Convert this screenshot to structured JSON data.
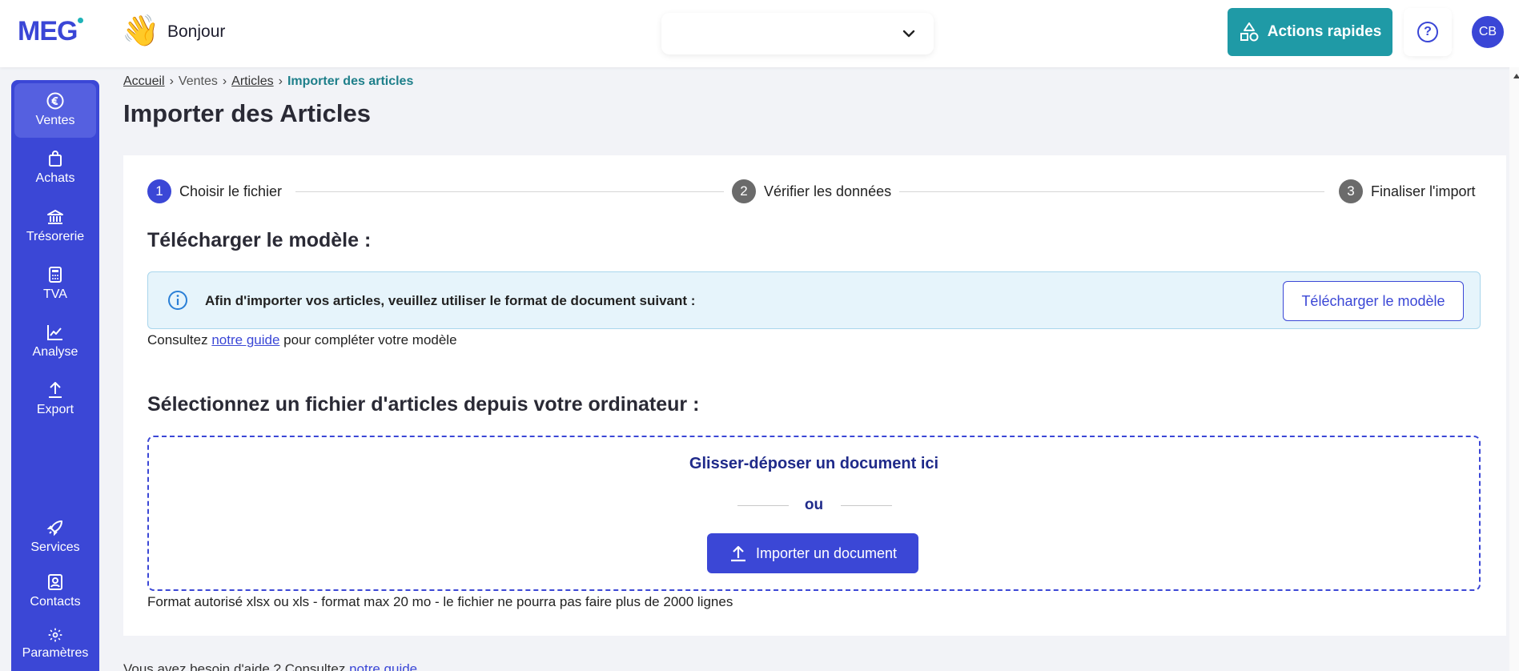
{
  "header": {
    "logo_text": "MEG",
    "wave_emoji": "👋",
    "greeting": "Bonjour",
    "company_select_value": "",
    "quick_actions_label": "Actions rapides",
    "help_symbol": "?",
    "avatar_initials": "CB"
  },
  "sidebar": {
    "items": [
      {
        "label": "Ventes",
        "icon": "euro-icon",
        "active": true
      },
      {
        "label": "Achats",
        "icon": "shopping-bag-icon",
        "active": false
      },
      {
        "label": "Trésorerie",
        "icon": "bank-icon",
        "active": false
      },
      {
        "label": "TVA",
        "icon": "calculator-icon",
        "active": false
      },
      {
        "label": "Analyse",
        "icon": "chart-line-icon",
        "active": false
      },
      {
        "label": "Export",
        "icon": "upload-icon",
        "active": false
      },
      {
        "label": "Services",
        "icon": "rocket-icon",
        "active": false
      },
      {
        "label": "Contacts",
        "icon": "contact-card-icon",
        "active": false
      },
      {
        "label": "Paramètres",
        "icon": "gear-icon",
        "active": false
      }
    ]
  },
  "breadcrumb": {
    "items": [
      "Accueil",
      "Ventes",
      "Articles"
    ],
    "current": "Importer des articles"
  },
  "page": {
    "title": "Importer des Articles"
  },
  "stepper": {
    "steps": [
      {
        "num": "1",
        "label": "Choisir le fichier",
        "active": true
      },
      {
        "num": "2",
        "label": "Vérifier les données",
        "active": false
      },
      {
        "num": "3",
        "label": "Finaliser l'import",
        "active": false
      }
    ]
  },
  "template_section": {
    "title": "Télécharger le modèle :",
    "info_text": "Afin d'importer vos articles, veuillez utiliser le format de document suivant :",
    "download_button": "Télécharger le modèle",
    "guide_prefix": "Consultez",
    "guide_link": "notre guide",
    "guide_suffix": "pour compléter votre modèle"
  },
  "upload_section": {
    "title": "Sélectionnez un fichier d'articles depuis votre ordinateur :",
    "drop_text": "Glisser-déposer un document ici",
    "or_text": "ou",
    "import_button": "Importer un document",
    "format_note": "Format autorisé xlsx ou xls - format max 20 mo - le fichier ne pourra pas faire plus de 2000 lignes"
  },
  "footer_help": {
    "prefix": "Vous avez besoin d'aide ? Consultez",
    "link": "notre guide"
  },
  "colors": {
    "brand": "#3b47d6",
    "accent_teal": "#1f9aa6",
    "info_bg": "#e6f4fb"
  }
}
